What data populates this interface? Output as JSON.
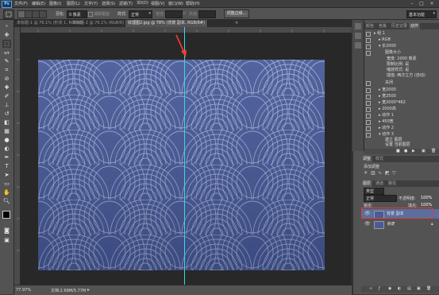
{
  "app": {
    "logo": "Ps"
  },
  "menu": [
    "文件(F)",
    "编辑(E)",
    "图像(I)",
    "图层(L)",
    "文字(Y)",
    "选择(S)",
    "滤镜(T)",
    "3D(D)",
    "视图(V)",
    "窗口(W)",
    "帮助(H)"
  ],
  "window_controls": [
    "–",
    "□",
    "×"
  ],
  "options_bar": {
    "feather_label": "羽化:",
    "feather_value": "0 像素",
    "antialias_label": "消除锯齿",
    "style_label": "样式:",
    "style_value": "正常",
    "width_label": "宽度:",
    "height_label": "高度:",
    "refine_edge_button": "调整边缘...",
    "workspace_value": "基本功能"
  },
  "tabs": [
    {
      "label": "未标题-1 @ 76.1% (形状 1, RGB/8)"
    },
    {
      "label": "未标题-2 @ 76.1% (RGB/8)"
    },
    {
      "label": "纹理图2.jpg @ 78% (背景 副本, RGB/8#)",
      "active": true
    }
  ],
  "statusbar": {
    "zoom": "77.97%",
    "doc_info": "文档:2.69M/5.77M"
  },
  "panels": {
    "top_tabs": [
      "颜色",
      "色板",
      "历史记录",
      "动作"
    ],
    "actions": [
      {
        "label": "▸ 组 1",
        "level": 0
      },
      {
        "label": "▸ RGB",
        "level": 1
      },
      {
        "label": "▾ 长2000",
        "level": 1
      },
      {
        "label": "图像大小",
        "level": 2
      },
      {
        "label": "宽度: 2000 像素",
        "level": 2
      },
      {
        "label": "限制比例: 是",
        "level": 2
      },
      {
        "label": "缩放样式: 是",
        "level": 2
      },
      {
        "label": "插值: 两次立方 (自动)",
        "level": 2
      },
      {
        "label": "关闭",
        "level": 2
      },
      {
        "label": "▸ 宽2000",
        "level": 1
      },
      {
        "label": "▸ 宽2500",
        "level": 1
      },
      {
        "label": "▸ 宽2000*462",
        "level": 1
      },
      {
        "label": "▸ 2000高",
        "level": 1
      },
      {
        "label": "▸ 动作 1",
        "level": 1
      },
      {
        "label": "▸ 450宽",
        "level": 1
      },
      {
        "label": "▸ 动作 2",
        "level": 1
      },
      {
        "label": "▾ 动作 3",
        "level": 1
      },
      {
        "label": "建立 图层",
        "level": 2
      },
      {
        "label": "设置 当前图层",
        "level": 2
      }
    ],
    "adjust_tabs": [
      "调整",
      "样式"
    ],
    "adjust_label": "添加调整",
    "layers_tabs": [
      "图层",
      "通道",
      "路径"
    ],
    "layer_filter": "类型",
    "blend_mode": "正常",
    "opacity_label": "不透明度:",
    "opacity_value": "100%",
    "lock_label": "锁定:",
    "fill_label": "填充:",
    "fill_value": "100%",
    "layers": [
      {
        "name": "背景 副本",
        "selected": true
      },
      {
        "name": "背景",
        "selected": false
      }
    ]
  },
  "colors": {
    "highlight_box": "#e8383d",
    "guide": "#39d6e8",
    "arrow": "#ff3b30",
    "pattern_base": "#4a5c96"
  }
}
